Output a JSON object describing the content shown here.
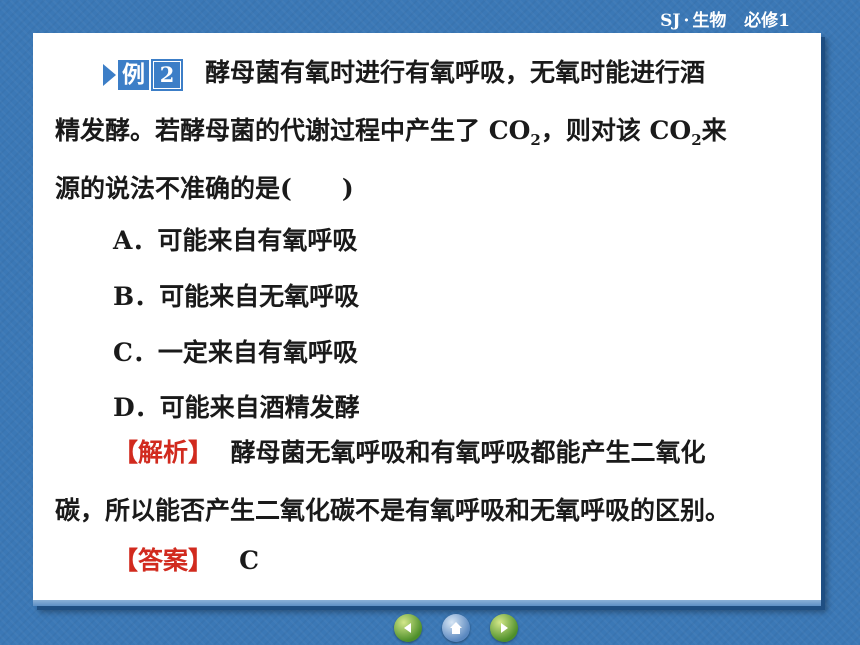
{
  "header": {
    "left": "SJ",
    "sep": "·",
    "subject": "生物",
    "course": "必修1"
  },
  "example": {
    "word": "例",
    "number": "2"
  },
  "question": {
    "line1": "酵母菌有氧时进行有氧呼吸，无氧时能进行酒",
    "line2_prefix": "精发酵。若酵母菌的代谢过程中产生了 CO",
    "sub": "2",
    "line2_mid": "，则对该 CO",
    "line2_end": "来",
    "line3": "源的说法不准确的是(　　)"
  },
  "options": [
    "A．可能来自有氧呼吸",
    "B．可能来自无氧呼吸",
    "C．一定来自有氧呼吸",
    "D．可能来自酒精发酵"
  ],
  "analysis": {
    "label": "【解析】",
    "line1": "酵母菌无氧呼吸和有氧呼吸都能产生二氧化",
    "line2": "碳，所以能否产生二氧化碳不是有氧呼吸和无氧呼吸的区别。"
  },
  "answer": {
    "label": "【答案】",
    "value": "C"
  },
  "nav": {
    "icons": [
      "prev-icon",
      "home-icon",
      "next-icon"
    ]
  }
}
